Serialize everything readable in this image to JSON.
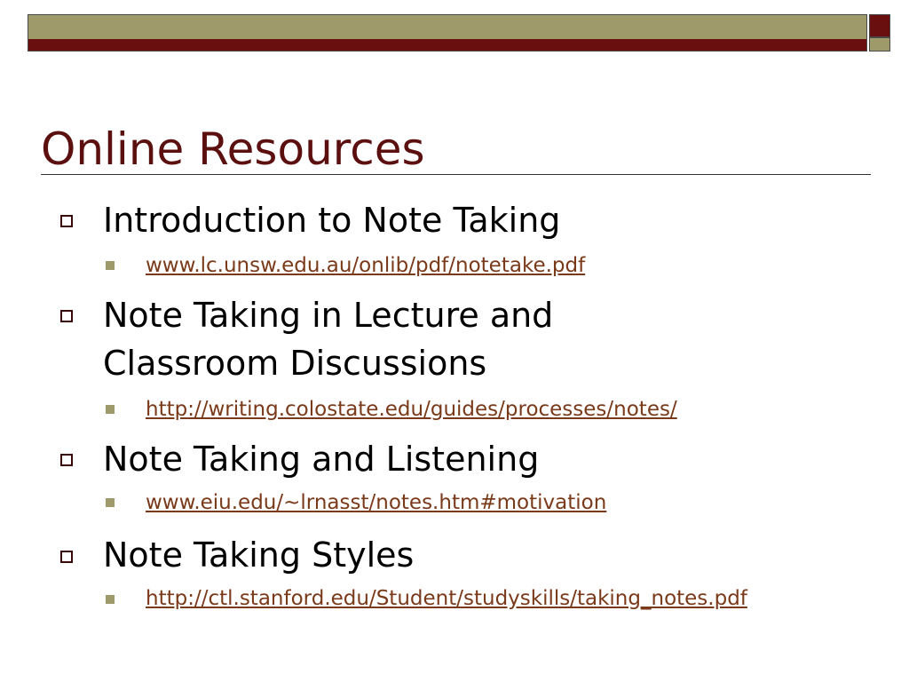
{
  "slide": {
    "title": "Online Resources",
    "items": [
      {
        "heading": "Introduction to Note Taking",
        "link": "www.lc.unsw.edu.au/onlib/pdf/notetake.pdf"
      },
      {
        "heading": "Note Taking in Lecture and Classroom Discussions",
        "link": "http://writing.colostate.edu/guides/processes/notes/"
      },
      {
        "heading": "Note Taking and Listening",
        "link": "www.eiu.edu/~lrnasst/notes.htm#motivation"
      },
      {
        "heading": "Note Taking Styles",
        "link": "http://ctl.stanford.edu/Student/studyskills/taking_notes.pdf"
      }
    ]
  },
  "colors": {
    "olive": "#9e9a69",
    "maroon": "#6a0f0f",
    "title": "#5c0f0f",
    "link": "#7a3a1a"
  }
}
